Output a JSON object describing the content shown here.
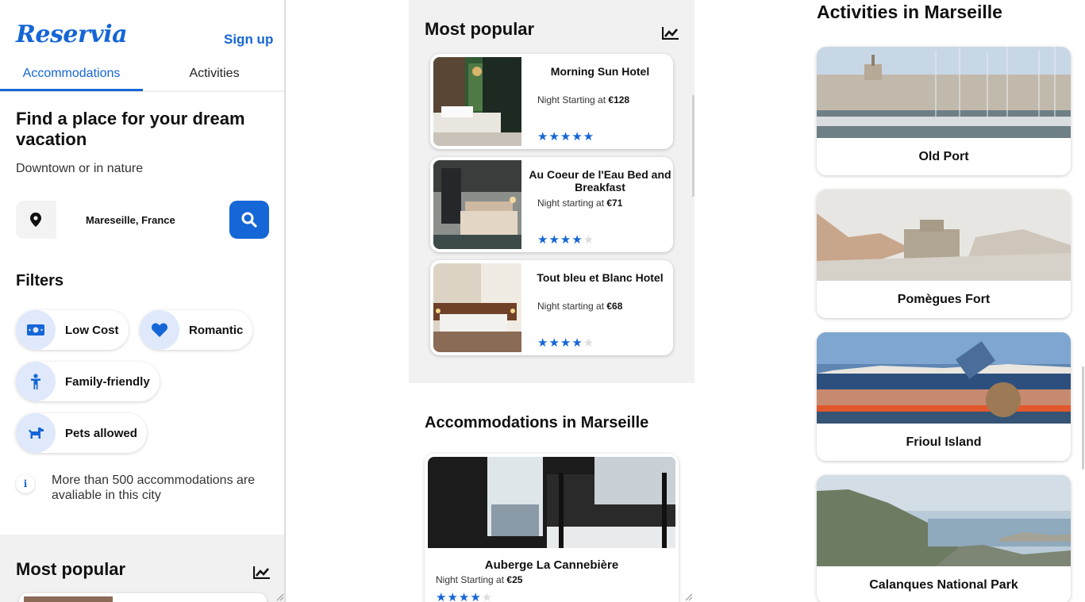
{
  "app": {
    "brand": "Reservia",
    "signup_label": "Sign up"
  },
  "tabs": [
    {
      "label": "Accommodations",
      "active": true
    },
    {
      "label": "Activities",
      "active": false
    }
  ],
  "hero": {
    "title": "Find a place for your dream vacation",
    "subtitle": "Downtown or in nature"
  },
  "search": {
    "value": "Mareseille, France",
    "location_icon": "map-pin-icon",
    "button_icon": "search-icon"
  },
  "filters": {
    "title": "Filters",
    "items": [
      {
        "label": "Low Cost",
        "icon": "money-icon"
      },
      {
        "label": "Romantic",
        "icon": "heart-icon"
      },
      {
        "label": "Family-friendly",
        "icon": "child-icon"
      },
      {
        "label": "Pets allowed",
        "icon": "dog-icon"
      }
    ]
  },
  "info": {
    "text": "More than 500 accommodations are avaliable in this city"
  },
  "most_popular": {
    "title": "Most popular",
    "items": [
      {
        "name": "Morning Sun Hotel",
        "price_prefix": "Night Starting at ",
        "price": "€128",
        "rating": 5
      },
      {
        "name": "Au Coeur de l'Eau Bed and Breakfast",
        "price_prefix": "Night starting at ",
        "price": "€71",
        "rating": 4
      },
      {
        "name": "Tout bleu et Blanc Hotel",
        "price_prefix": "Night starting at ",
        "price": "€68",
        "rating": 4
      }
    ]
  },
  "accommodations": {
    "title": "Accommodations in Marseille",
    "items": [
      {
        "name": "Auberge La Cannebière",
        "price_prefix": "Night Starting at ",
        "price": "€25",
        "rating": 4
      }
    ]
  },
  "activities": {
    "title": "Activities in Marseille",
    "items": [
      {
        "name": "Old Port"
      },
      {
        "name": "Pomègues Fort"
      },
      {
        "name": "Frioul Island"
      },
      {
        "name": "Calanques National Park"
      }
    ]
  },
  "colors": {
    "accent": "#1566d6",
    "chip_bg": "#dfe9fb",
    "section_bg": "#f1f1f1"
  }
}
